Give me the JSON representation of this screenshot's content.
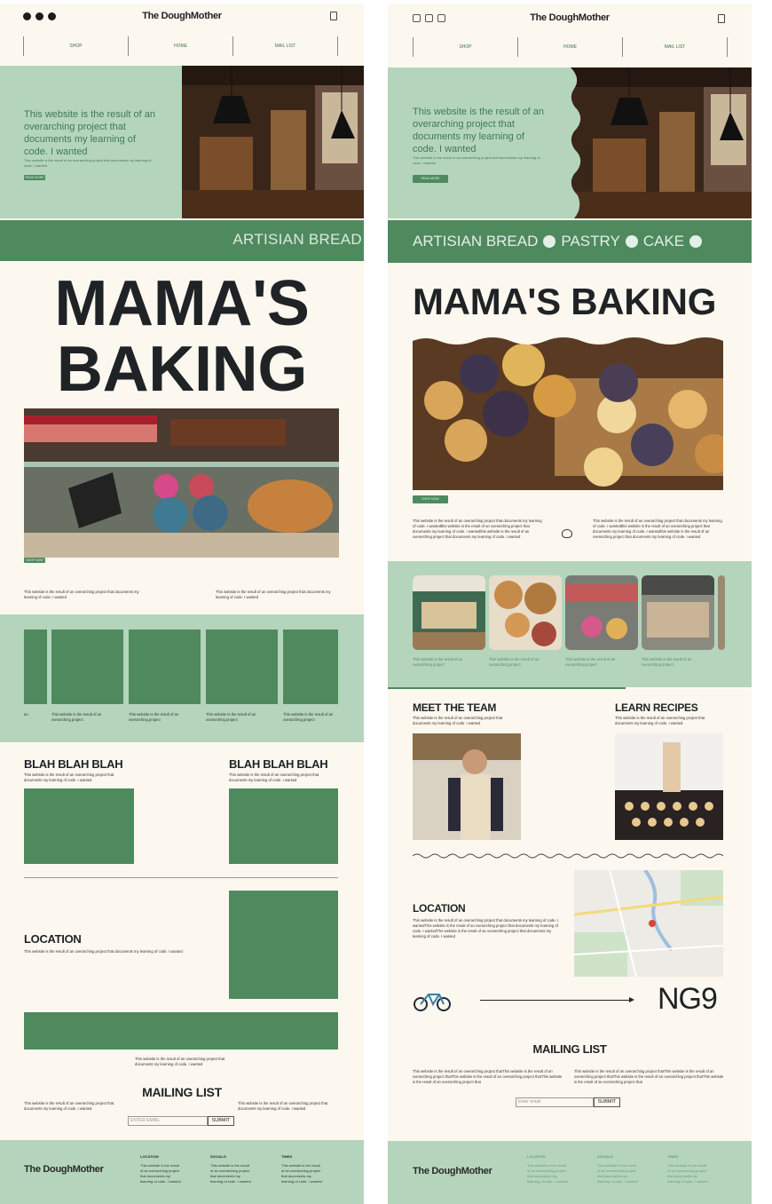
{
  "brand": "The DoughMother",
  "nav": [
    "SHOP",
    "HOME",
    "MAIL LIST"
  ],
  "hero": {
    "heading": "This website is the result of an overarching project that documents my learning of code. I wanted",
    "subtext": "This website is the result of an overarching project that documents my learning of code. I wanted",
    "button": "READ MORE"
  },
  "left": {
    "banner": "ARTISIAN BREAD",
    "title_line1": "MAMA'S",
    "title_line2": "BAKING",
    "shop_button": "SHOP NOW",
    "para_a": "This website is the result of an overarching project that documents my learning of code. I wanted",
    "para_b": "This website is the result of an overarching project that documents my learning of code. I wanted",
    "gallery_first": "an",
    "gallery_caption": "This website is the result of an overarching project",
    "blah_left": "BLAH BLAH BLAH",
    "blah_right": "BLAH BLAH BLAH",
    "blah_text": "This website is the result of an overarching project that documents my learning of code. I wanted",
    "location_title": "LOCATION",
    "location_text": "This website is the result of an overarching project that documents my learning of code. I wanted",
    "under_map_text": "This website is the result of an overarching project that documents my learning of code. I wanted",
    "mailing_title": "MAILING LIST",
    "mail_left": "This website is the result of an overarching project that documents my learning of code. I wanted",
    "mail_right": "This website is the result of an overarching project that documents my learning of code. I wanted",
    "email_placeholder": "ENTER EMAIL",
    "submit": "SUBMIT"
  },
  "right": {
    "banner": [
      "ARTISIAN BREAD",
      "PASTRY",
      "CAKE"
    ],
    "title": "MAMA'S BAKING",
    "shop_button": "SHOP NOW",
    "para_a": "This website is the result of an overarching project that documents my learning of code. I wantedthis website is the result of an overarching project that documents my learning of code. I wantedthis website is the result of an overarching project that documents my learning of code. I wanted",
    "para_b": "This website is the result of an overarching project that documents my learning of code. I wantedthis website is the result of an overarching project that documents my learning of code. I wantedthis website is the result of an overarching project that documents my learning of code. I wanted",
    "gallery_caption": "This website is the result of an overarching project",
    "team_title": "MEET THE TEAM",
    "team_text": "This website is the result of an overarching project that documents my learning of code. I wanted",
    "recipes_title": "LEARN RECIPES",
    "recipes_text": "This website is the result of an overarching project that documents my learning of code. I wanted",
    "location_title": "LOCATION",
    "location_text": "This website is the result of an overarching project that documents my learning of code. I wantedThis website is the result of an overarching project that documents my learning of code. I wantedThe website is the result of an overarching project that documents my learning of code. I wanted",
    "postcode": "NG9",
    "mailing_title": "MAILING LIST",
    "mail_left": "This website is the result of an overarching project thatThis website is the result of an overarching project thatThis website is the result of an overarching project thatThis website is the result of an overarching project that",
    "mail_right": "This website is the result of an overarching project thatThis website is the result of an overarching project thatThis website is the result of an overarching project thatThis website is the result of an overarching project that",
    "email_placeholder": "Enter email",
    "submit": "SUBMIT"
  },
  "footer": {
    "logo": "The DoughMother",
    "cols": [
      {
        "head": "LOCATION",
        "text": "This website is the result of an overarching project that documents my learning of code. I wanted"
      },
      {
        "head": "SOCIALS",
        "text": "This website is the result of an overarching project that documents my learning of code. I wanted"
      },
      {
        "head": "TIMES",
        "text": "This website is the result of an overarching project that documents my learning of code. I wanted"
      }
    ]
  },
  "colors": {
    "green": "#4f8a5f",
    "pale_green": "#b4d5bb",
    "cream": "#fdf8ef",
    "dark": "#1f2326"
  }
}
